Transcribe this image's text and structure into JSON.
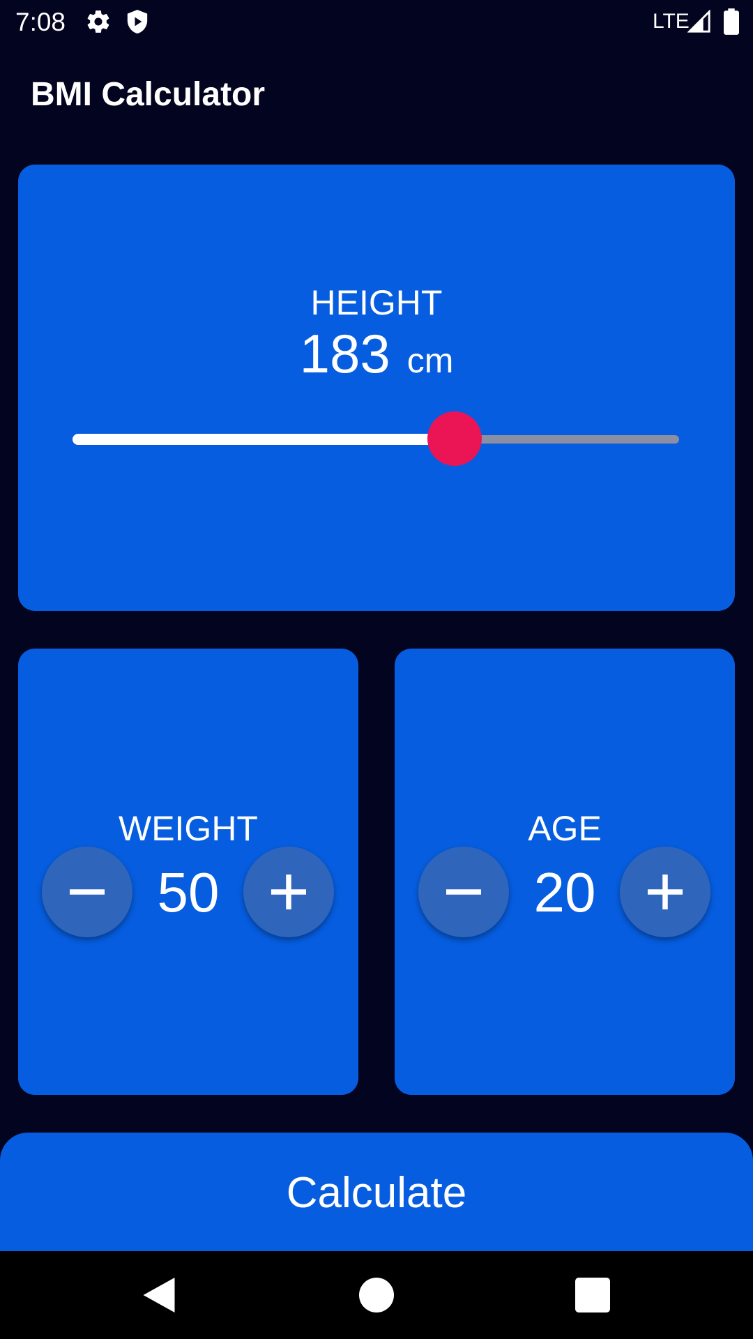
{
  "status_bar": {
    "time": "7:08",
    "network": "LTE",
    "icons": [
      "gear-icon",
      "shield-icon",
      "signal-icon",
      "battery-icon"
    ]
  },
  "app_bar": {
    "title": "BMI Calculator"
  },
  "height_card": {
    "label": "HEIGHT",
    "value": "183",
    "unit": "cm",
    "slider_fraction": 0.63
  },
  "weight_card": {
    "label": "WEIGHT",
    "value": "50"
  },
  "age_card": {
    "label": "AGE",
    "value": "20"
  },
  "calculate_button": {
    "label": "Calculate"
  },
  "nav_bar": {
    "icons": [
      "back-icon",
      "home-icon",
      "recents-icon"
    ]
  },
  "colors": {
    "background": "#03041f",
    "card": "#065ddf",
    "round_button": "#2f66bb",
    "slider_thumb": "#eb1555",
    "slider_inactive": "#8a8fa3",
    "text": "#ffffff"
  }
}
